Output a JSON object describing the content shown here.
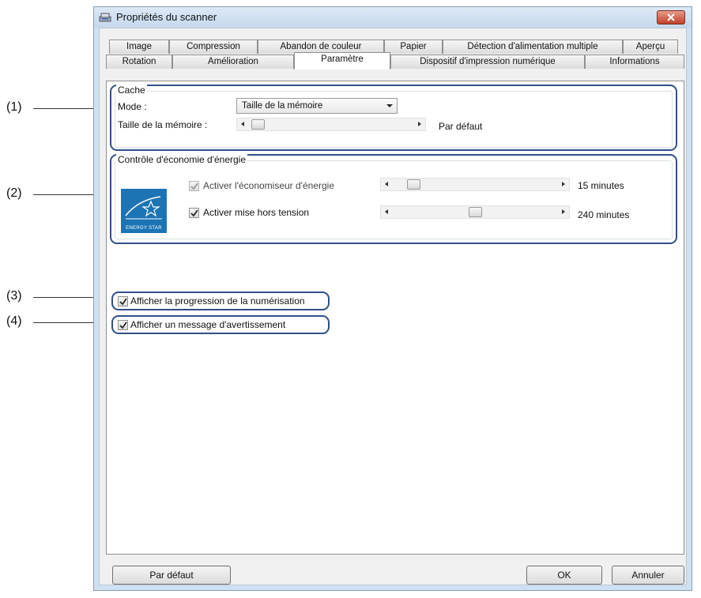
{
  "window": {
    "title": "Propriétés du scanner"
  },
  "callouts": [
    "(1)",
    "(2)",
    "(3)",
    "(4)"
  ],
  "tabs_back": [
    "Image",
    "Compression",
    "Abandon de couleur",
    "Papier",
    "Détection d'alimentation multiple",
    "Aperçu"
  ],
  "tabs_front": [
    "Rotation",
    "Amélioration",
    "Paramètre",
    "Dispositif d'impression numérique",
    "Informations"
  ],
  "active_tab": "Paramètre",
  "cache": {
    "title": "Cache",
    "mode_label": "Mode :",
    "mode_value": "Taille de la mémoire",
    "memory_label": "Taille de la mémoire :",
    "memory_value_text": "Par défaut",
    "memory_slider_level": 0.02
  },
  "energy": {
    "title": "Contrôle d'économie d'énergie",
    "logo_text": "ENERGY STAR",
    "saver_label": "Activer l'économiseur d'énergie",
    "saver_checked": true,
    "saver_enabled": false,
    "saver_value": "15 minutes",
    "saver_slider_level": 0.1,
    "poweroff_label": "Activer mise hors tension",
    "poweroff_checked": true,
    "poweroff_value": "240 minutes",
    "poweroff_slider_level": 0.5
  },
  "options": {
    "progress_label": "Afficher la progression de la numérisation",
    "progress_checked": true,
    "warning_label": "Afficher un message d'avertissement",
    "warning_checked": true
  },
  "buttons": {
    "default": "Par défaut",
    "ok": "OK",
    "cancel": "Annuler"
  },
  "colors": {
    "highlight": "#2f4f8a",
    "energy_star": "#1c74b5",
    "close_button": "#c2402a"
  }
}
